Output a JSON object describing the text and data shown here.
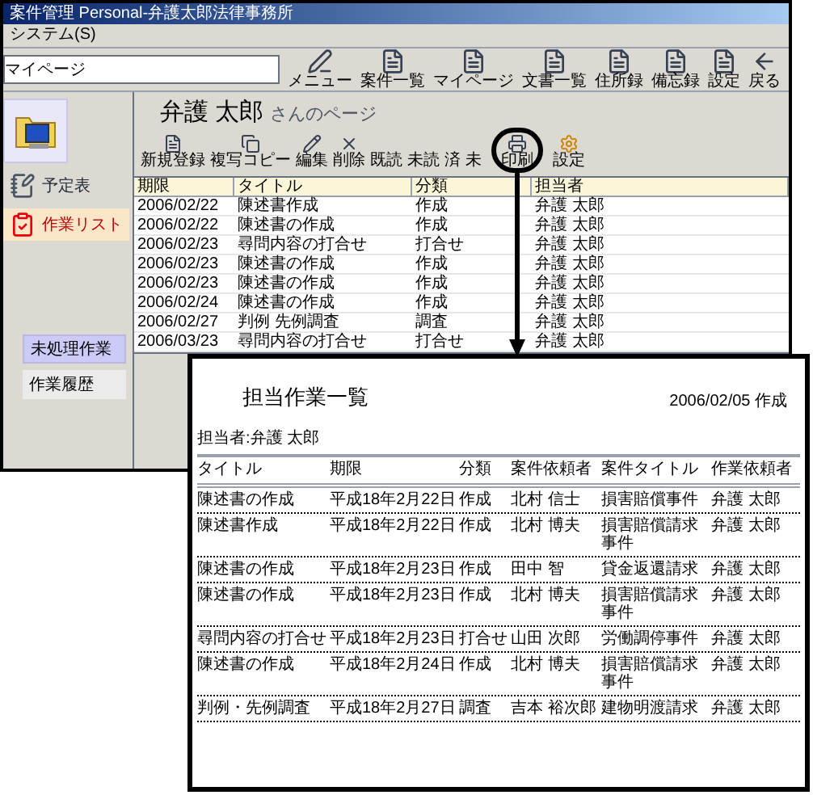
{
  "window": {
    "title": "案件管理 Personal-弁護太郎法律事務所"
  },
  "menu_bar": [
    "システム(S)"
  ],
  "address_field": {
    "value": "マイページ"
  },
  "toolbar": [
    {
      "label": "メニュー",
      "kind": "pen"
    },
    {
      "label": "案件一覧",
      "kind": "doc"
    },
    {
      "label": "マイページ",
      "kind": "doc"
    },
    {
      "label": "文書一覧",
      "kind": "doc"
    },
    {
      "label": "住所録",
      "kind": "doc"
    },
    {
      "label": "備忘録",
      "kind": "doc"
    },
    {
      "label": "設定",
      "kind": "doc"
    },
    {
      "label": "戻る",
      "kind": "back"
    }
  ],
  "sidebar": {
    "nav": [
      {
        "label": "予定表",
        "kind": "calendar",
        "selected": false
      },
      {
        "label": "作業リスト",
        "kind": "checklist",
        "selected": true
      }
    ],
    "filters": [
      {
        "label": "未処理作業",
        "selected": true
      },
      {
        "label": "作業履歴",
        "selected": false
      }
    ]
  },
  "page_heading": {
    "name": "弁護 太郎",
    "suffix": "さんのページ"
  },
  "actions": [
    {
      "label": "新規登録",
      "kind": "new",
      "highlighted": false
    },
    {
      "label": "複写コピー",
      "kind": "copy",
      "highlighted": false
    },
    {
      "label": "編集",
      "kind": "edit",
      "highlighted": false
    },
    {
      "label": "削除",
      "kind": "delete",
      "highlighted": false
    },
    {
      "label": "既読",
      "kind": "text",
      "highlighted": false
    },
    {
      "label": "未読",
      "kind": "text",
      "highlighted": false
    },
    {
      "label": "済",
      "kind": "text",
      "highlighted": false
    },
    {
      "label": "未",
      "kind": "text",
      "highlighted": false
    },
    {
      "label": "印刷",
      "kind": "print",
      "highlighted": true
    },
    {
      "label": "設定",
      "kind": "settings",
      "highlighted": false
    }
  ],
  "table": {
    "columns": [
      "期限",
      "タイトル",
      "分類",
      "担当者"
    ],
    "rows": [
      [
        "2006/02/22",
        "陳述書作成",
        "作成",
        "弁護 太郎"
      ],
      [
        "2006/02/22",
        "陳述書の作成",
        "作成",
        "弁護 太郎"
      ],
      [
        "2006/02/23",
        "尋問内容の打合せ",
        "打合せ",
        "弁護 太郎"
      ],
      [
        "2006/02/23",
        "陳述書の作成",
        "作成",
        "弁護 太郎"
      ],
      [
        "2006/02/23",
        "陳述書の作成",
        "作成",
        "弁護 太郎"
      ],
      [
        "2006/02/24",
        "陳述書の作成",
        "作成",
        "弁護 太郎"
      ],
      [
        "2006/02/27",
        "判例 先例調査",
        "調査",
        "弁護 太郎"
      ],
      [
        "2006/03/23",
        "尋問内容の打合せ",
        "打合せ",
        "弁護 太郎"
      ]
    ]
  },
  "report": {
    "title": "担当作業一覧",
    "created": "2006/02/05 作成",
    "assignee": "担当者:弁護 太郎",
    "columns": [
      "タイトル",
      "期限",
      "分類",
      "案件依頼者",
      "案件タイトル",
      "作業依頼者"
    ],
    "rows": [
      [
        "陳述書の作成",
        "平成18年2月22日",
        "作成",
        "北村 信士",
        "損害賠償事件",
        "弁護 太郎"
      ],
      [
        "陳述書作成",
        "平成18年2月22日",
        "作成",
        "北村 博夫",
        "損害賠償請求事件",
        "弁護 太郎"
      ],
      [
        "陳述書の作成",
        "平成18年2月23日",
        "作成",
        "田中 智",
        "貸金返還請求",
        "弁護 太郎"
      ],
      [
        "陳述書の作成",
        "平成18年2月23日",
        "作成",
        "北村 博夫",
        "損害賠償請求事件",
        "弁護 太郎"
      ],
      [
        "尋問内容の打合せ",
        "平成18年2月23日",
        "打合せ",
        "山田 次郎",
        "労働調停事件",
        "弁護 太郎"
      ],
      [
        "陳述書の作成",
        "平成18年2月24日",
        "作成",
        "北村 博夫",
        "損害賠償請求事件",
        "弁護 太郎"
      ],
      [
        "判例・先例調査",
        "平成18年2月27日",
        "調査",
        "吉本 裕次郎",
        "建物明渡請求",
        "弁護 太郎"
      ]
    ]
  }
}
